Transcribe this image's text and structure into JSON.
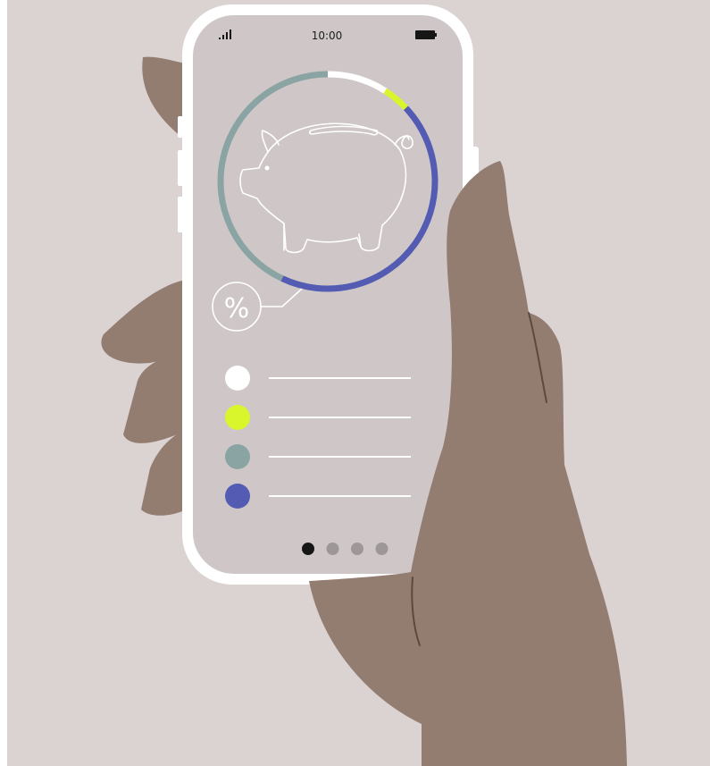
{
  "status_bar": {
    "time": "10:00",
    "signal_icon": "signal-bars-icon",
    "battery_icon": "battery-icon"
  },
  "savings_ring": {
    "center_icon": "piggy-bank-icon",
    "segments": [
      {
        "color": "#ffffff",
        "fraction": 0.09
      },
      {
        "color": "#d9f52c",
        "fraction": 0.04
      },
      {
        "color": "#535bb3",
        "fraction": 0.44
      },
      {
        "color": "#8aa3a3",
        "fraction": 0.43
      }
    ]
  },
  "percent_badge": {
    "symbol": "%"
  },
  "legend": {
    "items": [
      {
        "color": "#ffffff"
      },
      {
        "color": "#d9f52c"
      },
      {
        "color": "#8aa3a3"
      },
      {
        "color": "#535bb3"
      }
    ]
  },
  "pagination": {
    "count": 4,
    "active": 0
  },
  "colors": {
    "background": "#dbd2d2",
    "phone_frame": "#ffffff",
    "screen": "#cfc7c7",
    "hand": "#937c70",
    "dark": "#161616"
  }
}
